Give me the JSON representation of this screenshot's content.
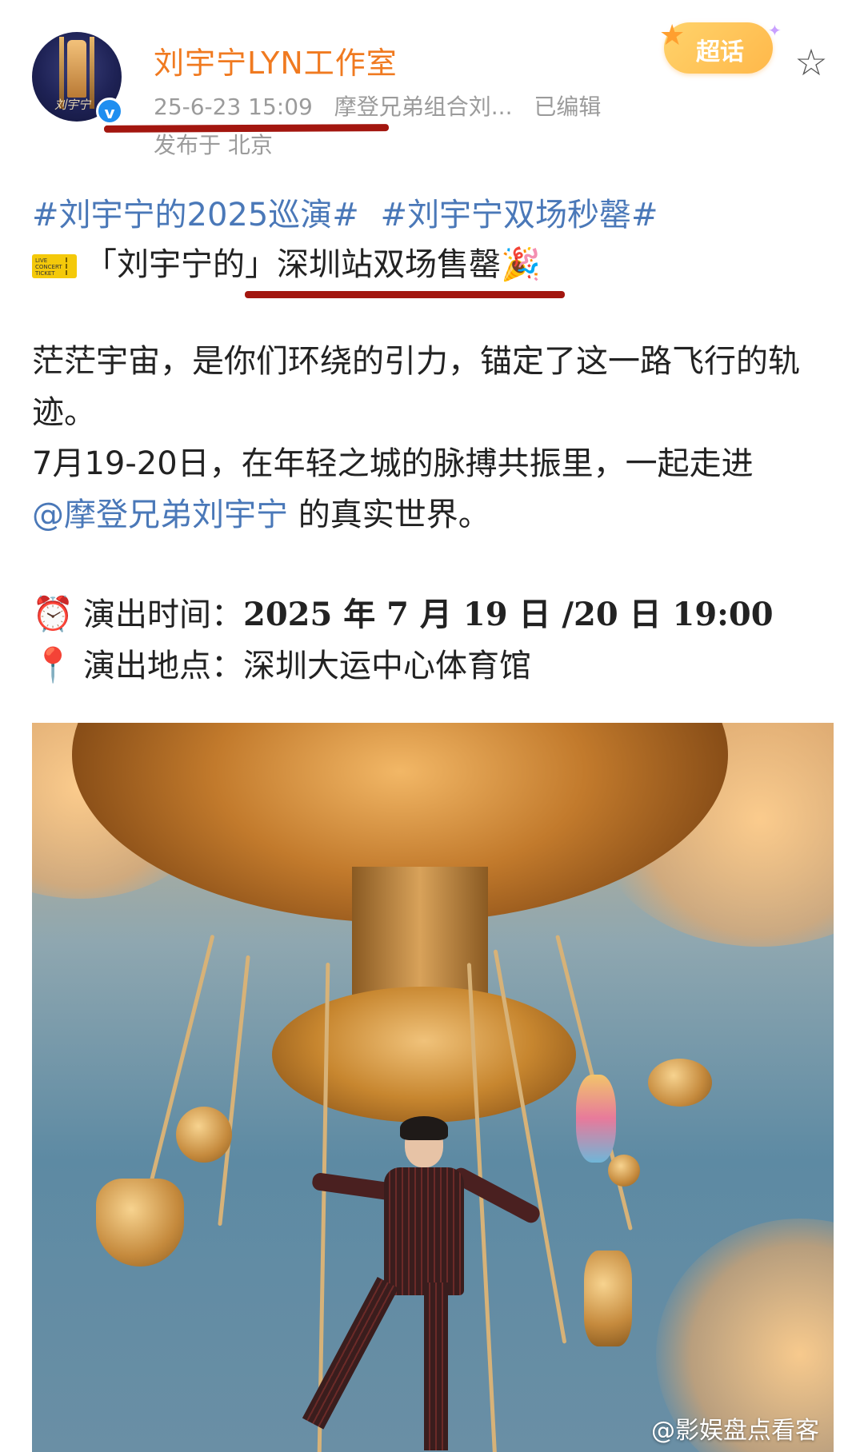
{
  "post": {
    "author": "刘宇宁LYN工作室",
    "timestamp": "25-6-23 15:09",
    "source": "摩登兄弟组合刘...",
    "edited": "已编辑",
    "location": "发布于 北京",
    "supertopic_label": "超话",
    "hashtags": [
      "#刘宇宁的2025巡演#",
      "#刘宇宁双场秒罄#"
    ],
    "headline": "「刘宇宁的」深圳站双场售罄",
    "body": [
      "茫茫宇宙，是你们环绕的引力，锚定了这一路飞行的轨迹。",
      "7月19-20日，在年轻之城的脉搏共振里，一起走进"
    ],
    "mention": "@摩登兄弟刘宇宁",
    "mention_suffix": " 的真实世界。",
    "time_label": "演出时间：",
    "time_value": "2025 年 7 月 19 日 /20 日 19:00",
    "venue_label": "演出地点：",
    "venue_value": "深圳大运中心体育馆",
    "watermark": "@影娱盘点看客"
  },
  "icons": {
    "verified": "verified-badge-icon",
    "star": "favorite-star-icon",
    "ticket": "ticket-icon",
    "party": "party-popper-icon",
    "clock": "alarm-clock-icon",
    "pin": "location-pin-icon"
  },
  "colors": {
    "author": "#f07a20",
    "link": "#4a78b8",
    "underline": "#a3160f",
    "meta": "#9b9b9b"
  }
}
